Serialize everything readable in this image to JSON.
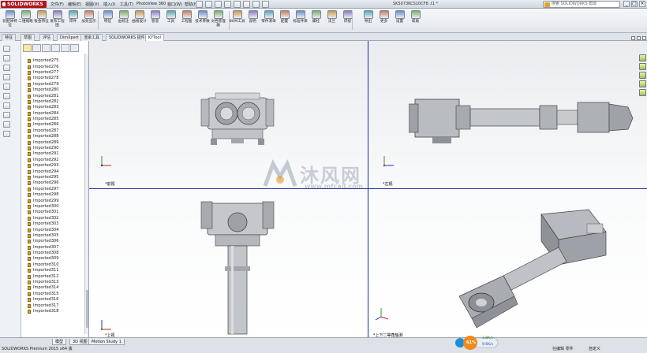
{
  "app": {
    "logo": "SOLIDWORKS",
    "menu": [
      "文件(F)",
      "编辑(E)",
      "视图(V)",
      "插入(I)",
      "工具(T)",
      "PhotoView 360",
      "窗口(W)",
      "帮助(H)"
    ],
    "document_title": "SK5073KCS10CF8 .t1 *",
    "search_placeholder": "搜索 SOLIDWORKS 帮助",
    "window_buttons": [
      "_",
      "□",
      "×"
    ]
  },
  "ribbon": {
    "buttons": [
      {
        "label": "装配体特征",
        "icon": "assembly-icon"
      },
      {
        "label": "二维缩略",
        "icon": "sketch-icon"
      },
      {
        "label": "钣金特征",
        "icon": "sheet-icon"
      },
      {
        "label": "发布工程图",
        "icon": "drawing-icon"
      },
      {
        "label": "焊件",
        "icon": "weld-icon"
      },
      {
        "label": "加亮显示",
        "icon": "highlight-icon"
      },
      {
        "label": "特征",
        "icon": "feature-icon"
      },
      {
        "label": "由标注",
        "icon": "dim-icon"
      },
      {
        "label": "曲线设计",
        "icon": "curve-icon"
      },
      {
        "label": "管道",
        "icon": "pipe-icon"
      },
      {
        "label": "工具",
        "icon": "tool-icon"
      },
      {
        "label": "工程图",
        "icon": "draw2-icon"
      },
      {
        "label": "技术参数",
        "icon": "param-icon"
      },
      {
        "label": "文档管理器",
        "icon": "docmgr-icon"
      },
      {
        "label": "BOM工具",
        "icon": "bom-icon"
      },
      {
        "label": "颜色",
        "icon": "color-icon"
      },
      {
        "label": "零件清单",
        "icon": "partlist-icon"
      },
      {
        "label": "配置",
        "icon": "config-icon"
      },
      {
        "label": "标准件库",
        "icon": "library-icon"
      },
      {
        "label": "螺栓",
        "icon": "bolt-icon"
      },
      {
        "label": "法兰",
        "icon": "flange-icon"
      },
      {
        "label": "焊接",
        "icon": "weld2-icon"
      },
      {
        "label": "导出",
        "icon": "export-icon"
      },
      {
        "label": "更多",
        "icon": "more-icon"
      },
      {
        "label": "设置",
        "icon": "settings-icon"
      },
      {
        "label": "帮助",
        "icon": "help-icon"
      }
    ]
  },
  "command_tabs": [
    "特征",
    "草图",
    "评估",
    "DimXpert",
    "渲染工具",
    "SOLIDWORKS 插件",
    "KYTool"
  ],
  "command_tab_active": 6,
  "tree": {
    "items": [
      "Imported275",
      "Imported276",
      "Imported277",
      "Imported278",
      "Imported279",
      "Imported280",
      "Imported281",
      "Imported282",
      "Imported283",
      "Imported284",
      "Imported285",
      "Imported286",
      "Imported287",
      "Imported288",
      "Imported289",
      "Imported290",
      "Imported291",
      "Imported292",
      "Imported293",
      "Imported294",
      "Imported295",
      "Imported296",
      "Imported297",
      "Imported298",
      "Imported299",
      "Imported300",
      "Imported301",
      "Imported302",
      "Imported303",
      "Imported304",
      "Imported305",
      "Imported306",
      "Imported307",
      "Imported308",
      "Imported309",
      "Imported310",
      "Imported311",
      "Imported312",
      "Imported313",
      "Imported314",
      "Imported315",
      "Imported316",
      "Imported317",
      "Imported318"
    ]
  },
  "views": {
    "front": "*前视",
    "left": "*左视",
    "top": "*上视",
    "iso": "*上下二等角轴测"
  },
  "watermark": {
    "text": "沐风网",
    "url": "www.mfcad.com"
  },
  "status": {
    "tabs": [
      "模型",
      "3D 视图",
      "Motion Study 1"
    ],
    "text": "SOLIDWORKS Premium 2015 x64 版",
    "right": "在编辑 零件",
    "units": "自定义",
    "tray_up": "3.8K/s",
    "tray_down": "9.6K/s",
    "tray_percent": "61%"
  },
  "colors": {
    "brand": "#b3121a",
    "viewport_divider": "#1f2f9a",
    "part_gray": "#9a9da3"
  }
}
